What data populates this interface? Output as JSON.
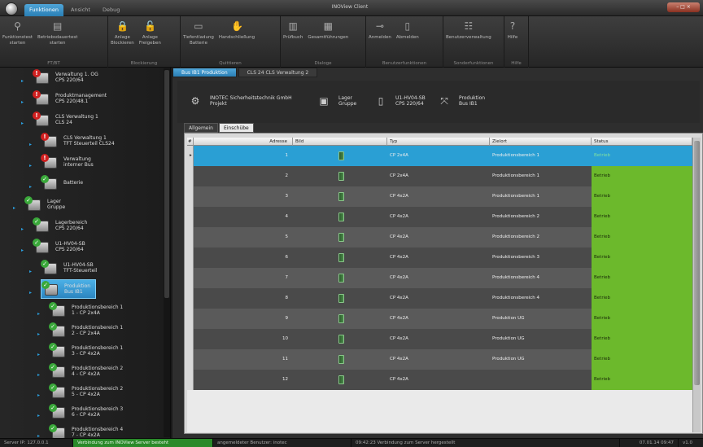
{
  "app": {
    "title": "INOView Client",
    "window_controls": "– □ ×"
  },
  "ribbon_tabs": [
    {
      "label": "Funktionen",
      "active": true
    },
    {
      "label": "Ansicht",
      "active": false
    },
    {
      "label": "Debug",
      "active": false
    }
  ],
  "ribbon_groups": [
    {
      "label": "FT/BT",
      "buttons": [
        {
          "label": "Funktionstest\nstarten",
          "icon": "function-test-icon"
        },
        {
          "label": "Betriebsdauertest\nstarten",
          "icon": "duration-test-icon"
        }
      ]
    },
    {
      "label": "Blockierung",
      "buttons": [
        {
          "label": "Anlage\nBlockieren",
          "icon": "lock-icon"
        },
        {
          "label": "Anlage\nFreigeben",
          "icon": "unlock-icon"
        }
      ]
    },
    {
      "label": "Quittieren",
      "buttons": [
        {
          "label": "Tiefentladung\nBatterie",
          "icon": "battery-icon"
        },
        {
          "label": "Handschließung",
          "icon": "hand-switch-icon"
        }
      ]
    },
    {
      "label": "Dialoge",
      "buttons": [
        {
          "label": "Prüfbuch",
          "icon": "test-book-icon"
        },
        {
          "label": "Gesamtführungen",
          "icon": "overview-icon"
        }
      ]
    },
    {
      "label": "Benutzerfunktionen",
      "buttons": [
        {
          "label": "Anmelden",
          "icon": "login-icon"
        },
        {
          "label": "Abmelden",
          "icon": "logout-icon"
        }
      ]
    },
    {
      "label": "Sonderfunktionen",
      "buttons": [
        {
          "label": "Benutzerverwaltung",
          "icon": "user-admin-icon"
        }
      ]
    },
    {
      "label": "Hilfe",
      "buttons": [
        {
          "label": "Hilfe",
          "icon": "help-icon"
        }
      ]
    }
  ],
  "tree": [
    {
      "text": "Verwaltung 1. OG\nCPS 220/64",
      "status": "err"
    },
    {
      "text": "Produktmanagement\nCPS 220/48.1",
      "status": "err"
    },
    {
      "text": "CLS Verwaltung 1\nCLS 24",
      "status": "err"
    },
    {
      "text": "CLS Verwaltung 1\nTFT Steuerteil CLS24",
      "status": "err"
    },
    {
      "text": "Verwaltung\ninterner Bus",
      "status": "err"
    },
    {
      "text": "Batterie",
      "status": "ok"
    },
    {
      "text": "Lager\nGruppe",
      "status": "ok"
    },
    {
      "text": "Lagerbereich\nCPS 220/64",
      "status": "ok"
    },
    {
      "text": "U1-HV04-SB\nCPS 220/64",
      "status": "ok"
    },
    {
      "text": "U1-HV04-SB\nTFT-Steuerteil",
      "status": "ok"
    },
    {
      "text": "Produktion\nBus IB1",
      "status": "ok",
      "selected": true
    },
    {
      "text": "Produktionsbereich 1\n1 - CP 2x4A",
      "status": "ok"
    },
    {
      "text": "Produktionsbereich 1\n2 - CP 2x4A",
      "status": "ok"
    },
    {
      "text": "Produktionsbereich 1\n3 - CP 4x2A",
      "status": "ok"
    },
    {
      "text": "Produktionsbereich 2\n4 - CP 4x2A",
      "status": "ok"
    },
    {
      "text": "Produktionsbereich 2\n5 - CP 4x2A",
      "status": "ok"
    },
    {
      "text": "Produktionsbereich 3\n6 - CP 4x2A",
      "status": "ok"
    },
    {
      "text": "Produktionsbereich 4\n7 - CP 4x2A",
      "status": "ok"
    }
  ],
  "doc_tabs": [
    {
      "label": "Bus IB1 Produktion",
      "active": true
    },
    {
      "label": "CLS 24 CLS Verwaltung 2",
      "active": false
    }
  ],
  "breadcrumb": [
    {
      "text": "INOTEC Sicherheitstechnik GmbH\nProjekt",
      "icon": "project-icon"
    },
    {
      "text": "Lager\nGruppe",
      "icon": "group-icon"
    },
    {
      "text": "U1-HV04-SB\nCPS 220/64",
      "icon": "device-icon"
    },
    {
      "text": "Produktion\nBus IB1",
      "icon": "bus-icon"
    }
  ],
  "sub_tabs": [
    {
      "label": "Allgemein",
      "active": false
    },
    {
      "label": "Einschübe",
      "active": true
    }
  ],
  "grid": {
    "columns": [
      "#",
      "Adresse",
      "Bild",
      "Typ",
      "Zielort",
      "Status"
    ],
    "rows": [
      {
        "adresse": "1",
        "typ": "CP 2x4A",
        "zielort": "Produktionsbereich 1",
        "status": "Betrieb"
      },
      {
        "adresse": "2",
        "typ": "CP 2x4A",
        "zielort": "Produktionsbereich 1",
        "status": "Betrieb"
      },
      {
        "adresse": "3",
        "typ": "CP 4x2A",
        "zielort": "Produktionsbereich 1",
        "status": "Betrieb"
      },
      {
        "adresse": "4",
        "typ": "CP 4x2A",
        "zielort": "Produktionsbereich 2",
        "status": "Betrieb"
      },
      {
        "adresse": "5",
        "typ": "CP 4x2A",
        "zielort": "Produktionsbereich 2",
        "status": "Betrieb"
      },
      {
        "adresse": "6",
        "typ": "CP 4x2A",
        "zielort": "Produktionsbereich 3",
        "status": "Betrieb"
      },
      {
        "adresse": "7",
        "typ": "CP 4x2A",
        "zielort": "Produktionsbereich 4",
        "status": "Betrieb"
      },
      {
        "adresse": "8",
        "typ": "CP 4x2A",
        "zielort": "Produktionsbereich 4",
        "status": "Betrieb"
      },
      {
        "adresse": "9",
        "typ": "CP 4x2A",
        "zielort": "Produktion UG",
        "status": "Betrieb"
      },
      {
        "adresse": "10",
        "typ": "CP 4x2A",
        "zielort": "Produktion UG",
        "status": "Betrieb"
      },
      {
        "adresse": "11",
        "typ": "CP 4x2A",
        "zielort": "Produktion UG",
        "status": "Betrieb"
      },
      {
        "adresse": "12",
        "typ": "CP 4x2A",
        "zielort": "",
        "status": "Betrieb"
      }
    ]
  },
  "statusbar": {
    "server": "Server IP: 127.0.0.1",
    "connection": "Verbindung zum INOView Server besteht",
    "user": "angemeldeter Benutzer: inotec",
    "event": "09:42:23 Verbindung zum Server hergestellt",
    "datetime": "07.01.14 09:47",
    "version": "v1.0"
  },
  "colors": {
    "accent": "#2a8fd0",
    "status_ok": "#6cb92c",
    "row_selected": "#2a9fd4",
    "row_dark": "#4a4a4a",
    "row_light": "#5a5a5a"
  }
}
